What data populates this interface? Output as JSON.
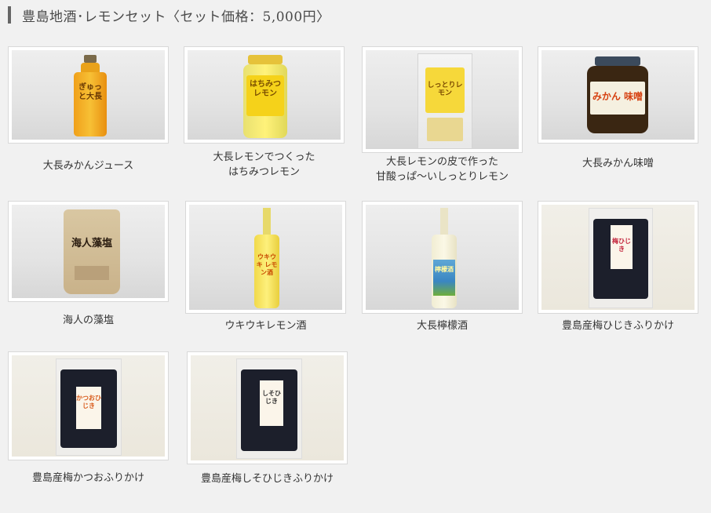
{
  "page": {
    "title": "豊島地酒･レモンセット〈セット価格：5,000円〉"
  },
  "products": [
    {
      "caption_lines": [
        "大長みかんジュース"
      ],
      "label_text": "ぎゅっと大長",
      "product_name": "orange-juice-bottle"
    },
    {
      "caption_lines": [
        "大長レモンでつくった",
        "はちみつレモン"
      ],
      "label_text": "はちみつレモン",
      "product_name": "honey-lemon-jar"
    },
    {
      "caption_lines": [
        "大長レモンの皮で作った",
        "甘酸っぱ〜いしっとりレモン"
      ],
      "label_text": "しっとりレモン",
      "product_name": "dried-lemon-peel-bag"
    },
    {
      "caption_lines": [
        "大長みかん味噌"
      ],
      "label_text": "みかん 味噌",
      "product_name": "mikan-miso-jar"
    },
    {
      "caption_lines": [
        "海人の藻塩"
      ],
      "label_text": "海人藻塩",
      "product_name": "seaweed-salt-bag"
    },
    {
      "caption_lines": [
        "ウキウキレモン酒"
      ],
      "label_text": "ウキウキ レモン酒",
      "product_name": "lemon-liqueur-bottle"
    },
    {
      "caption_lines": [
        "大長檸檬酒"
      ],
      "label_text": "檸檬酒",
      "product_name": "lemon-sake-bottle"
    },
    {
      "caption_lines": [
        "豊島産梅ひじきふりかけ"
      ],
      "label_text": "梅ひじき",
      "product_name": "ume-hijiki-furikake-bag"
    },
    {
      "caption_lines": [
        "豊島産梅かつおふりかけ"
      ],
      "label_text": "かつおひじき",
      "product_name": "ume-katsuo-furikake-bag"
    },
    {
      "caption_lines": [
        "豊島産梅しそひじきふりかけ"
      ],
      "label_text": "しそひじき",
      "product_name": "ume-shiso-hijiki-furikake-bag"
    }
  ]
}
